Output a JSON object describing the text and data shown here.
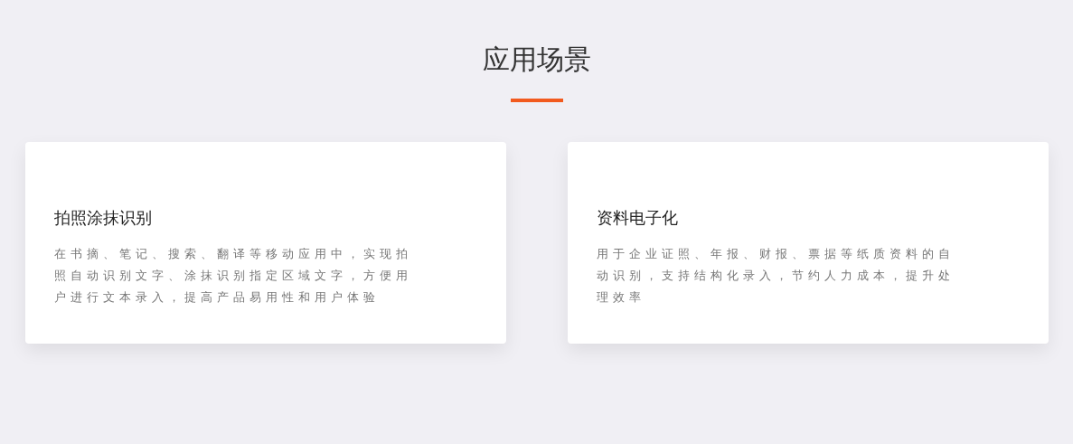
{
  "section": {
    "title": "应用场景"
  },
  "cards": [
    {
      "title": "拍照涂抹识别",
      "description": "在书摘、笔记、搜索、翻译等移动应用中，实现拍照自动识别文字、涂抹识别指定区域文字，方便用户进行文本录入，提高产品易用性和用户体验"
    },
    {
      "title": "资料电子化",
      "description": "用于企业证照、年报、财报、票据等纸质资料的自动识别，支持结构化录入，节约人力成本，提升处理效率"
    }
  ]
}
